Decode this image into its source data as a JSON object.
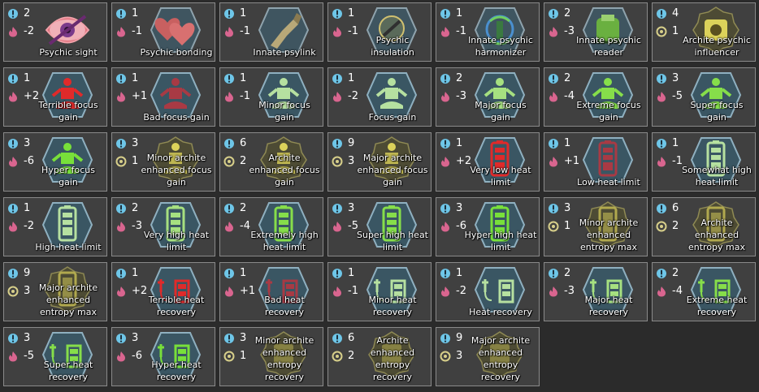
{
  "colors": {
    "complexity": "#6ec6e8",
    "metabolism": "#d9658f",
    "archite": "#d7cf8a",
    "background": "#2b2b2b",
    "tile": "#404040",
    "tile_border": "#8a8a8a"
  },
  "genes": [
    {
      "id": "psychic-sight",
      "label": "Psychic sight",
      "a": "2",
      "b": "-2",
      "b_icon": "metabolism-icon",
      "icon": "psychic-eye-icon",
      "theme": "pink"
    },
    {
      "id": "psychic-bonding",
      "label": "Psychic bonding",
      "a": "1",
      "b": "-1",
      "b_icon": "metabolism-icon",
      "icon": "hearts-icon",
      "theme": "slate"
    },
    {
      "id": "innate-psylink",
      "label": "Innate psylink",
      "a": "1",
      "b": "-1",
      "b_icon": "metabolism-icon",
      "icon": "psylink-arm-icon",
      "theme": "slate"
    },
    {
      "id": "psychic-insulation",
      "label": "Psychic insulation",
      "a": "1",
      "b": "-1",
      "b_icon": "metabolism-icon",
      "icon": "psychic-shield-icon",
      "theme": "slate"
    },
    {
      "id": "innate-psychic-harmonizer",
      "label": "Innate psychic harmonizer",
      "a": "1",
      "b": "-1",
      "b_icon": "metabolism-icon",
      "icon": "harmonizer-icon",
      "theme": "slate"
    },
    {
      "id": "innate-psychic-reader",
      "label": "Innate psychic reader",
      "a": "2",
      "b": "-3",
      "b_icon": "metabolism-icon",
      "icon": "reader-icon",
      "theme": "slate"
    },
    {
      "id": "archite-psychic-influencer",
      "label": "Archite psychic influencer",
      "a": "4",
      "b": "1",
      "b_icon": "archite-capsule-icon",
      "icon": "influencer-icon",
      "theme": "gold"
    },
    {
      "id": "terrible-focus-gain",
      "label": "Terrible focus gain",
      "a": "1",
      "b": "+2",
      "b_icon": "metabolism-icon",
      "icon": "focus-figure-icon",
      "theme": "red"
    },
    {
      "id": "bad-focus-gain",
      "label": "Bad focus gain",
      "a": "1",
      "b": "+1",
      "b_icon": "metabolism-icon",
      "icon": "focus-figure-icon",
      "theme": "darkred"
    },
    {
      "id": "minor-focus-gain",
      "label": "Minor focus gain",
      "a": "1",
      "b": "-1",
      "b_icon": "metabolism-icon",
      "icon": "focus-figure-icon",
      "theme": "palegreen"
    },
    {
      "id": "focus-gain",
      "label": "Focus gain",
      "a": "1",
      "b": "-2",
      "b_icon": "metabolism-icon",
      "icon": "focus-figure-icon",
      "theme": "palegreen"
    },
    {
      "id": "major-focus-gain",
      "label": "Major focus gain",
      "a": "2",
      "b": "-3",
      "b_icon": "metabolism-icon",
      "icon": "focus-figure-icon",
      "theme": "lightgreen"
    },
    {
      "id": "extreme-focus-gain",
      "label": "Extreme focus gain",
      "a": "2",
      "b": "-4",
      "b_icon": "metabolism-icon",
      "icon": "focus-figure-icon",
      "theme": "green"
    },
    {
      "id": "super-focus-gain",
      "label": "Super focus gain",
      "a": "3",
      "b": "-5",
      "b_icon": "metabolism-icon",
      "icon": "focus-figure-icon",
      "theme": "green"
    },
    {
      "id": "hyper-focus-gain",
      "label": "Hyper focus gain",
      "a": "3",
      "b": "-6",
      "b_icon": "metabolism-icon",
      "icon": "focus-figure-icon",
      "theme": "brightgreen"
    },
    {
      "id": "minor-archite-enhanced-focus-gain",
      "label": "Minor archite enhanced focus gain",
      "a": "3",
      "b": "1",
      "b_icon": "archite-capsule-icon",
      "icon": "archite-focus-icon",
      "theme": "gold"
    },
    {
      "id": "archite-enhanced-focus-gain",
      "label": "Archite enhanced focus gain",
      "a": "6",
      "b": "2",
      "b_icon": "archite-capsule-icon",
      "icon": "archite-focus-icon",
      "theme": "gold"
    },
    {
      "id": "major-archite-enhanced-focus-gain",
      "label": "Major archite enhanced focus gain",
      "a": "9",
      "b": "3",
      "b_icon": "archite-capsule-icon",
      "icon": "archite-focus-icon",
      "theme": "gold"
    },
    {
      "id": "very-low-heat-limit",
      "label": "Very low heat limit",
      "a": "1",
      "b": "+2",
      "b_icon": "metabolism-icon",
      "icon": "heat-battery-icon",
      "theme": "red"
    },
    {
      "id": "low-heat-limit",
      "label": "Low heat limit",
      "a": "1",
      "b": "+1",
      "b_icon": "metabolism-icon",
      "icon": "heat-battery-icon",
      "theme": "darkred"
    },
    {
      "id": "somewhat-high-heat-limit",
      "label": "Somewhat high heat limit",
      "a": "1",
      "b": "-1",
      "b_icon": "metabolism-icon",
      "icon": "heat-battery-icon",
      "theme": "palegreen"
    },
    {
      "id": "high-heat-limit",
      "label": "High heat limit",
      "a": "1",
      "b": "-2",
      "b_icon": "metabolism-icon",
      "icon": "heat-battery-icon",
      "theme": "palegreen"
    },
    {
      "id": "very-high-heat-limit",
      "label": "Very high heat limit",
      "a": "2",
      "b": "-3",
      "b_icon": "metabolism-icon",
      "icon": "heat-battery-icon",
      "theme": "lightgreen"
    },
    {
      "id": "extremely-high-heat-limit",
      "label": "Extremely high heat limit",
      "a": "2",
      "b": "-4",
      "b_icon": "metabolism-icon",
      "icon": "heat-battery-icon",
      "theme": "green"
    },
    {
      "id": "super-high-heat-limit",
      "label": "Super high heat limit",
      "a": "3",
      "b": "-5",
      "b_icon": "metabolism-icon",
      "icon": "heat-battery-icon",
      "theme": "green"
    },
    {
      "id": "hyper-high-heat-limit",
      "label": "Hyper high heat limit",
      "a": "3",
      "b": "-6",
      "b_icon": "metabolism-icon",
      "icon": "heat-battery-icon",
      "theme": "brightgreen"
    },
    {
      "id": "minor-archite-enhanced-entropy-max",
      "label": "Minor archite enhanced entropy max",
      "a": "3",
      "b": "1",
      "b_icon": "archite-capsule-icon",
      "icon": "archite-battery-icon",
      "theme": "gold"
    },
    {
      "id": "archite-enhanced-entropy-max",
      "label": "Archite enhanced entropy max",
      "a": "6",
      "b": "2",
      "b_icon": "archite-capsule-icon",
      "icon": "archite-battery-icon",
      "theme": "gold"
    },
    {
      "id": "major-archite-enhanced-entropy-max",
      "label": "Major archite enhanced entropy max",
      "a": "9",
      "b": "3",
      "b_icon": "archite-capsule-icon",
      "icon": "archite-battery-icon",
      "theme": "gold"
    },
    {
      "id": "terrible-heat-recovery",
      "label": "Terrible heat recovery",
      "a": "1",
      "b": "+2",
      "b_icon": "metabolism-icon",
      "icon": "heat-recovery-icon",
      "theme": "red"
    },
    {
      "id": "bad-heat-recovery",
      "label": "Bad heat recovery",
      "a": "1",
      "b": "+1",
      "b_icon": "metabolism-icon",
      "icon": "heat-recovery-icon",
      "theme": "darkred"
    },
    {
      "id": "minor-heat-recovery",
      "label": "Minor heat recovery",
      "a": "1",
      "b": "-1",
      "b_icon": "metabolism-icon",
      "icon": "heat-recovery-icon",
      "theme": "palegreen"
    },
    {
      "id": "heat-recovery",
      "label": "Heat recovery",
      "a": "1",
      "b": "-2",
      "b_icon": "metabolism-icon",
      "icon": "heat-recovery-icon",
      "theme": "palegreen"
    },
    {
      "id": "major-heat-recovery",
      "label": "Major heat recovery",
      "a": "2",
      "b": "-3",
      "b_icon": "metabolism-icon",
      "icon": "heat-recovery-icon",
      "theme": "lightgreen"
    },
    {
      "id": "extreme-heat-recovery",
      "label": "Extreme heat recovery",
      "a": "2",
      "b": "-4",
      "b_icon": "metabolism-icon",
      "icon": "heat-recovery-icon",
      "theme": "green"
    },
    {
      "id": "super-heat-recovery",
      "label": "Super heat recovery",
      "a": "3",
      "b": "-5",
      "b_icon": "metabolism-icon",
      "icon": "heat-recovery-icon",
      "theme": "green"
    },
    {
      "id": "hyper-heat-recovery",
      "label": "Hyper heat recovery",
      "a": "3",
      "b": "-6",
      "b_icon": "metabolism-icon",
      "icon": "heat-recovery-icon",
      "theme": "brightgreen"
    },
    {
      "id": "minor-archite-enhanced-entropy-recovery",
      "label": "Minor archite enhanced entropy recovery",
      "a": "3",
      "b": "1",
      "b_icon": "archite-capsule-icon",
      "icon": "archite-recovery-icon",
      "theme": "gold"
    },
    {
      "id": "archite-enhanced-entropy-recovery",
      "label": "Archite enhanced entropy recovery",
      "a": "6",
      "b": "2",
      "b_icon": "archite-capsule-icon",
      "icon": "archite-recovery-icon",
      "theme": "gold"
    },
    {
      "id": "major-archite-enhanced-entropy-recovery",
      "label": "Major archite enhanced entropy recovery",
      "a": "9",
      "b": "3",
      "b_icon": "archite-capsule-icon",
      "icon": "archite-recovery-icon",
      "theme": "gold"
    }
  ]
}
